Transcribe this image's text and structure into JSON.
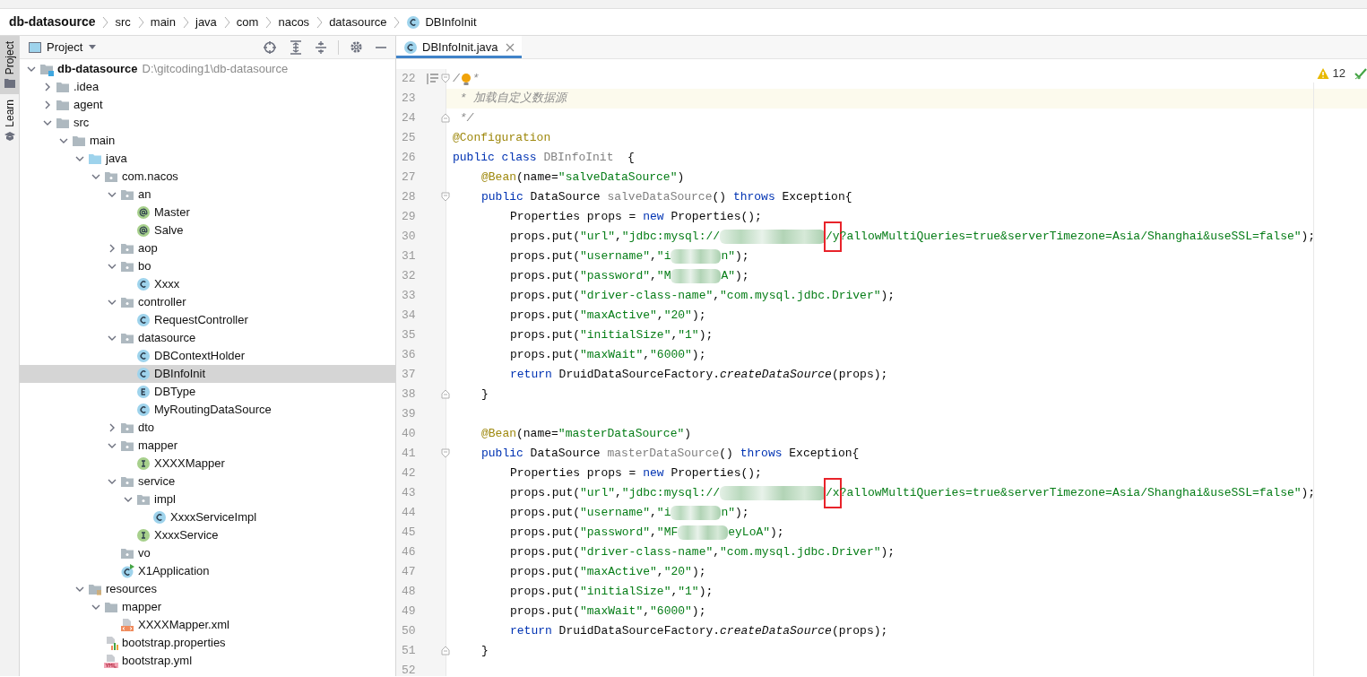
{
  "breadcrumbs": [
    {
      "label": "db-datasource",
      "kind": "module"
    },
    {
      "label": "src",
      "kind": "plain"
    },
    {
      "label": "main",
      "kind": "plain"
    },
    {
      "label": "java",
      "kind": "plain"
    },
    {
      "label": "com",
      "kind": "plain"
    },
    {
      "label": "nacos",
      "kind": "plain"
    },
    {
      "label": "datasource",
      "kind": "plain"
    },
    {
      "label": "DBInfoInit",
      "kind": "class"
    }
  ],
  "side_tabs": [
    {
      "label": "Project",
      "selected": true
    },
    {
      "label": "Learn",
      "selected": false
    }
  ],
  "project_panel": {
    "title": "Project",
    "tree": [
      {
        "label": "db-datasource",
        "hint": "D:\\gitcoding1\\db-datasource",
        "kind": "module",
        "expanded": true,
        "selected": false,
        "children": [
          {
            "label": ".idea",
            "kind": "folder",
            "expanded": false,
            "selected": false
          },
          {
            "label": "agent",
            "kind": "folder",
            "expanded": false,
            "selected": false
          },
          {
            "label": "src",
            "kind": "folder",
            "expanded": true,
            "selected": false,
            "children": [
              {
                "label": "main",
                "kind": "folder",
                "expanded": true,
                "selected": false,
                "children": [
                  {
                    "label": "java",
                    "kind": "source-folder",
                    "expanded": true,
                    "selected": false,
                    "children": [
                      {
                        "label": "com.nacos",
                        "kind": "package",
                        "expanded": true,
                        "selected": false,
                        "children": [
                          {
                            "label": "an",
                            "kind": "package",
                            "expanded": true,
                            "selected": false,
                            "children": [
                              {
                                "label": "Master",
                                "kind": "annotation",
                                "selected": false
                              },
                              {
                                "label": "Salve",
                                "kind": "annotation",
                                "selected": false
                              }
                            ]
                          },
                          {
                            "label": "aop",
                            "kind": "package",
                            "expanded": false,
                            "selected": false
                          },
                          {
                            "label": "bo",
                            "kind": "package",
                            "expanded": true,
                            "selected": false,
                            "children": [
                              {
                                "label": "Xxxx",
                                "kind": "class",
                                "selected": false
                              }
                            ]
                          },
                          {
                            "label": "controller",
                            "kind": "package",
                            "expanded": true,
                            "selected": false,
                            "children": [
                              {
                                "label": "RequestController",
                                "kind": "class",
                                "selected": false
                              }
                            ]
                          },
                          {
                            "label": "datasource",
                            "kind": "package",
                            "expanded": true,
                            "selected": false,
                            "children": [
                              {
                                "label": "DBContextHolder",
                                "kind": "class",
                                "selected": false
                              },
                              {
                                "label": "DBInfoInit",
                                "kind": "class",
                                "selected": true
                              },
                              {
                                "label": "DBType",
                                "kind": "enum",
                                "selected": false
                              },
                              {
                                "label": "MyRoutingDataSource",
                                "kind": "class",
                                "selected": false
                              }
                            ]
                          },
                          {
                            "label": "dto",
                            "kind": "package",
                            "expanded": false,
                            "selected": false
                          },
                          {
                            "label": "mapper",
                            "kind": "package",
                            "expanded": true,
                            "selected": false,
                            "children": [
                              {
                                "label": "XXXXMapper",
                                "kind": "interface",
                                "selected": false
                              }
                            ]
                          },
                          {
                            "label": "service",
                            "kind": "package",
                            "expanded": true,
                            "selected": false,
                            "children": [
                              {
                                "label": "impl",
                                "kind": "package",
                                "expanded": true,
                                "selected": false,
                                "children": [
                                  {
                                    "label": "XxxxServiceImpl",
                                    "kind": "class",
                                    "selected": false
                                  }
                                ]
                              },
                              {
                                "label": "XxxxService",
                                "kind": "interface",
                                "selected": false
                              }
                            ]
                          },
                          {
                            "label": "vo",
                            "kind": "package",
                            "selected": false
                          },
                          {
                            "label": "X1Application",
                            "kind": "app-class",
                            "selected": false
                          }
                        ]
                      }
                    ]
                  },
                  {
                    "label": "resources",
                    "kind": "resources-folder",
                    "expanded": true,
                    "selected": false,
                    "children": [
                      {
                        "label": "mapper",
                        "kind": "folder",
                        "expanded": true,
                        "selected": false,
                        "children": [
                          {
                            "label": "XXXXMapper.xml",
                            "kind": "xml",
                            "selected": false
                          }
                        ]
                      },
                      {
                        "label": "bootstrap.properties",
                        "kind": "properties",
                        "selected": false
                      },
                      {
                        "label": "bootstrap.yml",
                        "kind": "yml",
                        "selected": false
                      }
                    ]
                  }
                ]
              }
            ]
          }
        ]
      }
    ]
  },
  "editor": {
    "tabs": [
      {
        "label": "DBInfoInit.java",
        "selected": true
      }
    ],
    "inspections": {
      "warnings": "12"
    },
    "lines": [
      {
        "num": "22",
        "kind": "top",
        "fold_start": true,
        "gutter_mark": true,
        "tokens": [
          {
            "kind": "comment",
            "text": "/"
          },
          {
            "kind": "bulb"
          },
          {
            "kind": "comment",
            "text": "*"
          }
        ]
      },
      {
        "num": "23",
        "kind": "top",
        "highlighted": true,
        "tokens": [
          {
            "kind": "comment",
            "text": " * 加载自定义数据源"
          }
        ]
      },
      {
        "num": "24",
        "kind": "top",
        "fold_end": true,
        "tokens": [
          {
            "kind": "comment",
            "text": " */"
          }
        ]
      },
      {
        "num": "25",
        "kind": "top",
        "tokens": [
          {
            "kind": "annotation",
            "text": "@Configuration"
          }
        ]
      },
      {
        "num": "26",
        "kind": "top",
        "tokens": [
          {
            "kind": "keyword",
            "text": "public class "
          },
          {
            "kind": "unused",
            "text": "DBInfoInit"
          },
          {
            "kind": "plain",
            "text": "  {"
          }
        ]
      },
      {
        "num": "27",
        "kind": "member",
        "tokens": [
          {
            "kind": "annotation",
            "text": "@Bean"
          },
          {
            "kind": "plain",
            "text": "(name="
          },
          {
            "kind": "string",
            "text": "\"salveDataSource\""
          },
          {
            "kind": "plain",
            "text": ")"
          }
        ]
      },
      {
        "num": "28",
        "kind": "member",
        "fold_start": true,
        "tokens": [
          {
            "kind": "keyword",
            "text": "public "
          },
          {
            "kind": "plain",
            "text": "DataSource "
          },
          {
            "kind": "unused",
            "text": "salveDataSource"
          },
          {
            "kind": "plain",
            "text": "() "
          },
          {
            "kind": "keyword",
            "text": "throws "
          },
          {
            "kind": "plain",
            "text": "Exception{"
          }
        ]
      },
      {
        "num": "29",
        "kind": "body",
        "tokens": [
          {
            "kind": "plain",
            "text": "Properties props = "
          },
          {
            "kind": "keyword",
            "text": "new "
          },
          {
            "kind": "plain",
            "text": "Properties();"
          }
        ]
      },
      {
        "num": "30",
        "kind": "body",
        "tokens": [
          {
            "kind": "plain",
            "text": "props.put("
          },
          {
            "kind": "string",
            "text": "\"url\""
          },
          {
            "kind": "plain",
            "text": ","
          },
          {
            "kind": "string",
            "text": "\"jdbc:mysql://"
          },
          {
            "kind": "blur-long"
          },
          {
            "kind": "marked",
            "text": "/y"
          },
          {
            "kind": "string",
            "text": "?allowMultiQueries=true&serverTimezone=Asia/Shanghai&useSSL=false\""
          },
          {
            "kind": "plain",
            "text": ");"
          }
        ]
      },
      {
        "num": "31",
        "kind": "body",
        "tokens": [
          {
            "kind": "plain",
            "text": "props.put("
          },
          {
            "kind": "string",
            "text": "\"username\""
          },
          {
            "kind": "plain",
            "text": ","
          },
          {
            "kind": "string",
            "text": "\"i"
          },
          {
            "kind": "blur"
          },
          {
            "kind": "string",
            "text": "n\""
          },
          {
            "kind": "plain",
            "text": ");"
          }
        ]
      },
      {
        "num": "32",
        "kind": "body",
        "tokens": [
          {
            "kind": "plain",
            "text": "props.put("
          },
          {
            "kind": "string",
            "text": "\"password\""
          },
          {
            "kind": "plain",
            "text": ","
          },
          {
            "kind": "string",
            "text": "\"M"
          },
          {
            "kind": "blur"
          },
          {
            "kind": "string",
            "text": "A\""
          },
          {
            "kind": "plain",
            "text": ");"
          }
        ]
      },
      {
        "num": "33",
        "kind": "body",
        "tokens": [
          {
            "kind": "plain",
            "text": "props.put("
          },
          {
            "kind": "string",
            "text": "\"driver-class-name\""
          },
          {
            "kind": "plain",
            "text": ","
          },
          {
            "kind": "string",
            "text": "\"com.mysql.jdbc.Driver\""
          },
          {
            "kind": "plain",
            "text": ");"
          }
        ]
      },
      {
        "num": "34",
        "kind": "body",
        "tokens": [
          {
            "kind": "plain",
            "text": "props.put("
          },
          {
            "kind": "string",
            "text": "\"maxActive\""
          },
          {
            "kind": "plain",
            "text": ","
          },
          {
            "kind": "string",
            "text": "\"20\""
          },
          {
            "kind": "plain",
            "text": ");"
          }
        ]
      },
      {
        "num": "35",
        "kind": "body",
        "tokens": [
          {
            "kind": "plain",
            "text": "props.put("
          },
          {
            "kind": "string",
            "text": "\"initialSize\""
          },
          {
            "kind": "plain",
            "text": ","
          },
          {
            "kind": "string",
            "text": "\"1\""
          },
          {
            "kind": "plain",
            "text": ");"
          }
        ]
      },
      {
        "num": "36",
        "kind": "body",
        "tokens": [
          {
            "kind": "plain",
            "text": "props.put("
          },
          {
            "kind": "string",
            "text": "\"maxWait\""
          },
          {
            "kind": "plain",
            "text": ","
          },
          {
            "kind": "string",
            "text": "\"6000\""
          },
          {
            "kind": "plain",
            "text": ");"
          }
        ]
      },
      {
        "num": "37",
        "kind": "body",
        "tokens": [
          {
            "kind": "keyword",
            "text": "return "
          },
          {
            "kind": "plain",
            "text": "DruidDataSourceFactory."
          },
          {
            "kind": "static-call",
            "text": "createDataSource"
          },
          {
            "kind": "plain",
            "text": "(props);"
          }
        ]
      },
      {
        "num": "38",
        "kind": "member",
        "fold_end": true,
        "tokens": [
          {
            "kind": "plain",
            "text": "}"
          }
        ]
      },
      {
        "num": "39",
        "kind": "top"
      },
      {
        "num": "40",
        "kind": "member",
        "tokens": [
          {
            "kind": "annotation",
            "text": "@Bean"
          },
          {
            "kind": "plain",
            "text": "(name="
          },
          {
            "kind": "string",
            "text": "\"masterDataSource\""
          },
          {
            "kind": "plain",
            "text": ")"
          }
        ]
      },
      {
        "num": "41",
        "kind": "member",
        "fold_start": true,
        "tokens": [
          {
            "kind": "keyword",
            "text": "public "
          },
          {
            "kind": "plain",
            "text": "DataSource "
          },
          {
            "kind": "unused",
            "text": "masterDataSource"
          },
          {
            "kind": "plain",
            "text": "() "
          },
          {
            "kind": "keyword",
            "text": "throws "
          },
          {
            "kind": "plain",
            "text": "Exception{"
          }
        ]
      },
      {
        "num": "42",
        "kind": "body",
        "tokens": [
          {
            "kind": "plain",
            "text": "Properties props = "
          },
          {
            "kind": "keyword",
            "text": "new "
          },
          {
            "kind": "plain",
            "text": "Properties();"
          }
        ]
      },
      {
        "num": "43",
        "kind": "body",
        "tokens": [
          {
            "kind": "plain",
            "text": "props.put("
          },
          {
            "kind": "string",
            "text": "\"url\""
          },
          {
            "kind": "plain",
            "text": ","
          },
          {
            "kind": "string",
            "text": "\"jdbc:mysql://"
          },
          {
            "kind": "blur-long"
          },
          {
            "kind": "marked",
            "text": "/x"
          },
          {
            "kind": "string",
            "text": "?allowMultiQueries=true&serverTimezone=Asia/Shanghai&useSSL=false\""
          },
          {
            "kind": "plain",
            "text": ");"
          }
        ]
      },
      {
        "num": "44",
        "kind": "body",
        "tokens": [
          {
            "kind": "plain",
            "text": "props.put("
          },
          {
            "kind": "string",
            "text": "\"username\""
          },
          {
            "kind": "plain",
            "text": ","
          },
          {
            "kind": "string",
            "text": "\"i"
          },
          {
            "kind": "blur"
          },
          {
            "kind": "string",
            "text": "n\""
          },
          {
            "kind": "plain",
            "text": ");"
          }
        ]
      },
      {
        "num": "45",
        "kind": "body",
        "tokens": [
          {
            "kind": "plain",
            "text": "props.put("
          },
          {
            "kind": "string",
            "text": "\"password\""
          },
          {
            "kind": "plain",
            "text": ","
          },
          {
            "kind": "string",
            "text": "\"MF"
          },
          {
            "kind": "blur"
          },
          {
            "kind": "string",
            "text": "eyLoA\""
          },
          {
            "kind": "plain",
            "text": ");"
          }
        ]
      },
      {
        "num": "46",
        "kind": "body",
        "tokens": [
          {
            "kind": "plain",
            "text": "props.put("
          },
          {
            "kind": "string",
            "text": "\"driver-class-name\""
          },
          {
            "kind": "plain",
            "text": ","
          },
          {
            "kind": "string",
            "text": "\"com.mysql.jdbc.Driver\""
          },
          {
            "kind": "plain",
            "text": ");"
          }
        ]
      },
      {
        "num": "47",
        "kind": "body",
        "tokens": [
          {
            "kind": "plain",
            "text": "props.put("
          },
          {
            "kind": "string",
            "text": "\"maxActive\""
          },
          {
            "kind": "plain",
            "text": ","
          },
          {
            "kind": "string",
            "text": "\"20\""
          },
          {
            "kind": "plain",
            "text": ");"
          }
        ]
      },
      {
        "num": "48",
        "kind": "body",
        "tokens": [
          {
            "kind": "plain",
            "text": "props.put("
          },
          {
            "kind": "string",
            "text": "\"initialSize\""
          },
          {
            "kind": "plain",
            "text": ","
          },
          {
            "kind": "string",
            "text": "\"1\""
          },
          {
            "kind": "plain",
            "text": ");"
          }
        ]
      },
      {
        "num": "49",
        "kind": "body",
        "tokens": [
          {
            "kind": "plain",
            "text": "props.put("
          },
          {
            "kind": "string",
            "text": "\"maxWait\""
          },
          {
            "kind": "plain",
            "text": ","
          },
          {
            "kind": "string",
            "text": "\"6000\""
          },
          {
            "kind": "plain",
            "text": ");"
          }
        ]
      },
      {
        "num": "50",
        "kind": "body",
        "tokens": [
          {
            "kind": "keyword",
            "text": "return "
          },
          {
            "kind": "plain",
            "text": "DruidDataSourceFactory."
          },
          {
            "kind": "static-call",
            "text": "createDataSource"
          },
          {
            "kind": "plain",
            "text": "(props);"
          }
        ]
      },
      {
        "num": "51",
        "kind": "member",
        "fold_end": true,
        "tokens": [
          {
            "kind": "plain",
            "text": "}"
          }
        ]
      },
      {
        "num": "52",
        "kind": "top"
      }
    ]
  }
}
